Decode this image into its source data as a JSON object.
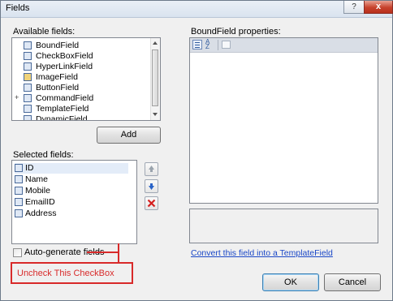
{
  "window": {
    "title": "Fields",
    "help_glyph": "?",
    "close_glyph": "x"
  },
  "available": {
    "label": "Available fields:",
    "items": [
      "BoundField",
      "CheckBoxField",
      "HyperLinkField",
      "ImageField",
      "ButtonField",
      "CommandField",
      "TemplateField",
      "DynamicField"
    ],
    "command_expand": "+",
    "add_label": "Add"
  },
  "selected": {
    "label": "Selected fields:",
    "items": [
      "ID",
      "Name",
      "Mobile",
      "EmailID",
      "Address"
    ]
  },
  "properties": {
    "label": "BoundField properties:"
  },
  "autogen": {
    "label": "Auto-generate fields",
    "checked": false
  },
  "convert_link": "Convert this field into a TemplateField",
  "annotation": {
    "text": "Uncheck This CheckBox",
    "color": "#d82a2a"
  },
  "buttons": {
    "ok": "OK",
    "cancel": "Cancel"
  },
  "colors": {
    "accent_link": "#1a47c7",
    "delete_red": "#d42020",
    "arrow_blue": "#2a64c8"
  }
}
